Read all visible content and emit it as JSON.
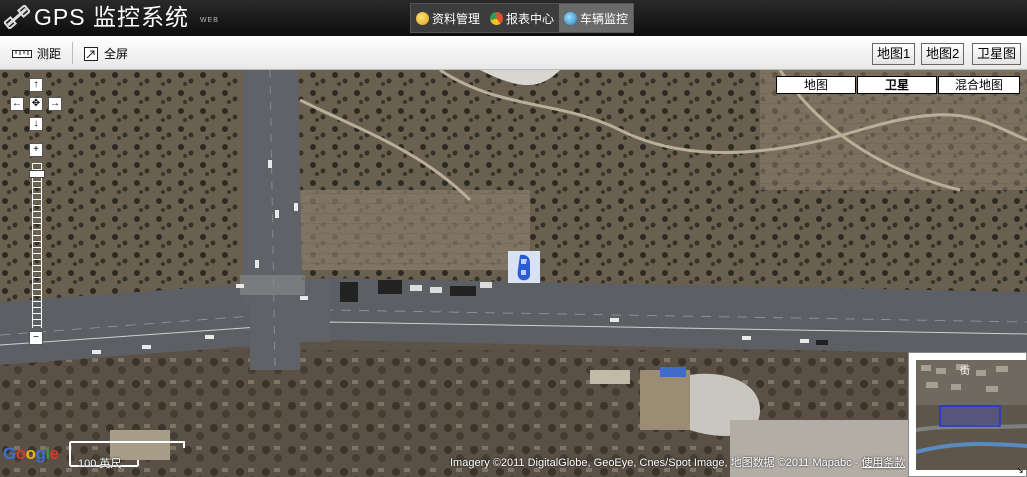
{
  "header": {
    "title": "GPS 监控系统",
    "subtitle": "WEB",
    "nav": [
      {
        "label": "资料管理",
        "icon": "folder-icon",
        "color": "#f0c020"
      },
      {
        "label": "报表中心",
        "icon": "chart-icon",
        "color": "#e05030"
      },
      {
        "label": "车辆监控",
        "icon": "monitor-icon",
        "color": "#30a0e0",
        "active": true
      }
    ]
  },
  "toolbar": {
    "measure_label": "测距",
    "fullscreen_label": "全屏",
    "map_buttons": [
      "地图1",
      "地图2",
      "卫星图"
    ]
  },
  "map": {
    "type_buttons": [
      "地图",
      "卫星",
      "混合地图"
    ],
    "active_type": "卫星",
    "scale_label": "100 英尺",
    "attribution": "Imagery ©2011 DigitalGlobe, GeoEye, Cnes/Spot Image, 地图数据 ©2011 Mapabc - ",
    "terms_label": "使用条款",
    "logo_letters": [
      "G",
      "o",
      "o",
      "g",
      "l",
      "e"
    ],
    "logo_colors": [
      "#3b6fd8",
      "#d23b2b",
      "#e8b318",
      "#3b6fd8",
      "#3a9c3a",
      "#d23b2b"
    ]
  },
  "colors": {
    "header_bg": "#1a1a1a",
    "toolbar_bg": "#f2f2f2",
    "road": "#5c5f63",
    "terrain": "#6b6152"
  }
}
